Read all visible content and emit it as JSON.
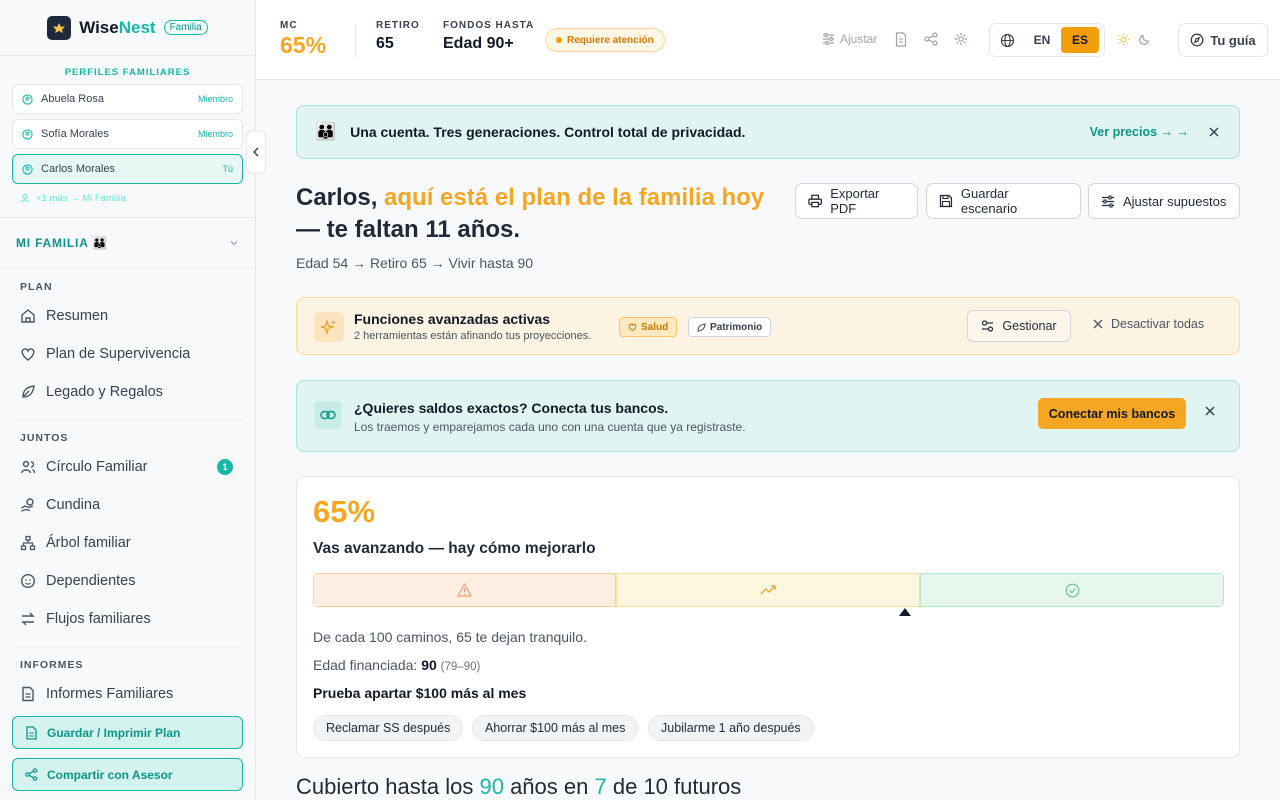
{
  "brand": {
    "name_a": "Wise",
    "name_b": "Nest",
    "badge": "Familia"
  },
  "profiles": {
    "title": "PERFILES FAMILIARES",
    "items": [
      {
        "name": "Abuela Rosa",
        "role": "Miembro"
      },
      {
        "name": "Sofía Morales",
        "role": "Miembro"
      },
      {
        "name": "Carlos Morales",
        "role": "Tú"
      }
    ],
    "more": "+1 más → Mi Familia"
  },
  "family_section": {
    "label": "MI FAMILIA 👪"
  },
  "nav": {
    "plan_title": "PLAN",
    "plan_items": [
      "Resumen",
      "Plan de Supervivencia",
      "Legado y Regalos"
    ],
    "juntos_title": "JUNTOS",
    "juntos_items": [
      "Círculo Familiar",
      "Cundina",
      "Árbol familiar",
      "Dependientes",
      "Flujos familiares"
    ],
    "circle_badge": "1",
    "informes_title": "INFORMES",
    "informes_items": [
      "Informes Familiares"
    ]
  },
  "sidebar_actions": {
    "save": "Guardar / Imprimir Plan",
    "share": "Compartir con Asesor"
  },
  "topbar": {
    "mc_label": "MC",
    "mc_value": "65%",
    "retiro_label": "RETIRO",
    "retiro_value": "65",
    "fondos_label": "FONDOS HASTA",
    "fondos_value": "Edad 90+",
    "attention": "Requiere atención",
    "ajustar": "Ajustar",
    "lang_en": "EN",
    "lang_es": "ES",
    "guide": "Tu guía"
  },
  "promo": {
    "text": "Una cuenta. Tres generaciones. Control total de privacidad.",
    "link": "Ver precios → →"
  },
  "hero": {
    "name": "Carlos,",
    "highlight": "aquí está el plan de la familia hoy",
    "rest": "— te faltan 11 años.",
    "subtitle": "Edad 54 → Retiro 65 → Vivir hasta 90"
  },
  "actions": {
    "export": "Exportar PDF",
    "save": "Guardar escenario",
    "adjust": "Ajustar supuestos"
  },
  "advanced": {
    "title": "Funciones avanzadas activas",
    "subtitle": "2 herramientas están afinando tus proyecciones.",
    "chip_health": "Salud",
    "chip_wealth": "Patrimonio",
    "manage": "Gestionar",
    "disable": "Desactivar todas"
  },
  "bank": {
    "title": "¿Quieres saldos exactos? Conecta tus bancos.",
    "subtitle": "Los traemos y emparejamos cada uno con una cuenta que ya registraste.",
    "button": "Conectar mis bancos"
  },
  "score": {
    "percent": "65%",
    "verdict": "Vas avanzando — hay cómo mejorarlo",
    "marker_fraction": 0.65,
    "line1": "De cada 100 caminos, 65 te dejan tranquilo.",
    "funded_label": "Edad financiada:",
    "funded_value": "90",
    "funded_range": "(79–90)",
    "tip": "Prueba apartar $100 más al mes",
    "pills": [
      "Reclamar SS después",
      "Ahorrar $100 más al mes",
      "Jubilarme 1 año después"
    ]
  },
  "bottom": {
    "a": "Cubierto hasta los",
    "age": "90",
    "b": "años en",
    "count": "7",
    "c": "de 10 futuros"
  },
  "colors": {
    "accent": "#f5a623",
    "brand": "#14b8a6"
  }
}
